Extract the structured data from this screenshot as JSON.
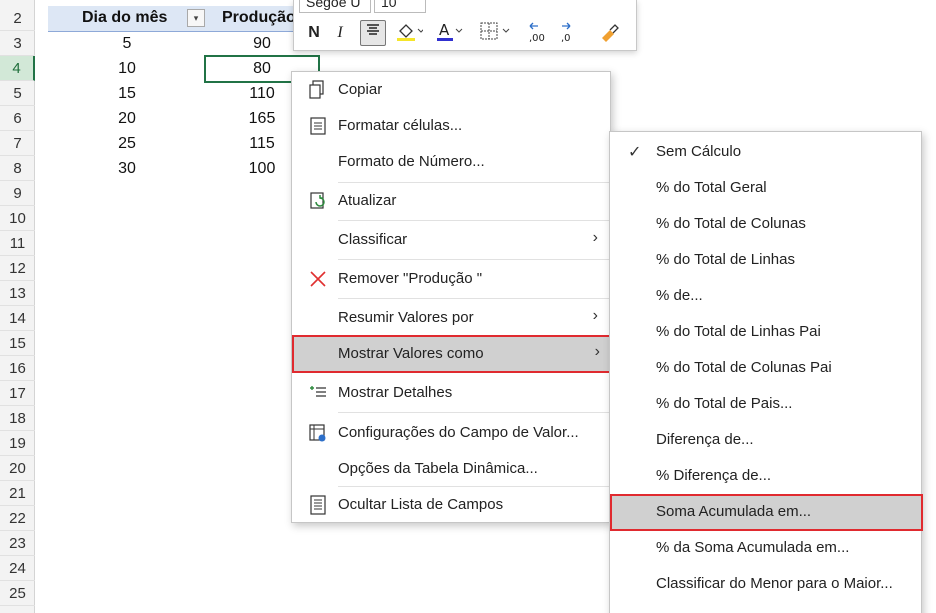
{
  "row_numbers": [
    "2",
    "3",
    "4",
    "5",
    "6",
    "7",
    "8",
    "9",
    "10",
    "11",
    "12",
    "13",
    "14",
    "15",
    "16",
    "17",
    "18",
    "19",
    "20",
    "21",
    "22",
    "23",
    "24",
    "25"
  ],
  "pivot": {
    "header_day": "Dia do mês",
    "header_prod": "Produção",
    "dropdown_glyph": "▾",
    "rows": [
      {
        "day": "5",
        "prod": "90"
      },
      {
        "day": "10",
        "prod": "80"
      },
      {
        "day": "15",
        "prod": "110"
      },
      {
        "day": "20",
        "prod": "165"
      },
      {
        "day": "25",
        "prod": "115"
      },
      {
        "day": "30",
        "prod": "100"
      }
    ]
  },
  "mini_toolbar": {
    "font_name": "Segoe U",
    "font_size": "10",
    "bold": "N",
    "italic": "I"
  },
  "context_menu": {
    "items": [
      {
        "label": "Copiar",
        "icon": "copy-icon"
      },
      {
        "label": "Formatar células...",
        "icon": "format-cells-icon"
      },
      {
        "label": "Formato de Número...",
        "icon": ""
      },
      {
        "label": "Atualizar",
        "icon": "refresh-icon"
      },
      {
        "label": "Classificar",
        "icon": "",
        "submenu": true
      },
      {
        "label": "Remover \"Produção \"",
        "icon": "remove-x-icon"
      },
      {
        "label": "Resumir Valores por",
        "icon": "",
        "submenu": true
      },
      {
        "label": "Mostrar Valores como",
        "icon": "",
        "submenu": true,
        "highlighted": true
      },
      {
        "label": "Mostrar Detalhes",
        "icon": "show-details-icon"
      },
      {
        "label": "Configurações do Campo de Valor...",
        "icon": "field-settings-icon"
      },
      {
        "label": "Opções da Tabela Dinâmica...",
        "icon": ""
      },
      {
        "label": "Ocultar Lista de Campos",
        "icon": "field-list-icon"
      }
    ]
  },
  "submenu": {
    "items": [
      {
        "label": "Sem Cálculo",
        "checked": true
      },
      {
        "label": "% do Total Geral"
      },
      {
        "label": "% do Total de Colunas"
      },
      {
        "label": "% do Total de Linhas"
      },
      {
        "label": "% de..."
      },
      {
        "label": "% do Total de Linhas Pai"
      },
      {
        "label": "% do Total de Colunas Pai"
      },
      {
        "label": "% do Total de Pais..."
      },
      {
        "label": "Diferença de..."
      },
      {
        "label": "% Diferença de..."
      },
      {
        "label": "Soma Acumulada em...",
        "highlighted": true
      },
      {
        "label": "% da Soma Acumulada em..."
      },
      {
        "label": "Classificar do Menor para o Maior..."
      }
    ]
  },
  "colors": {
    "highlight_border": "#e02a2f",
    "selection_green": "#217346",
    "pivot_header_bg": "#dde7f5"
  }
}
